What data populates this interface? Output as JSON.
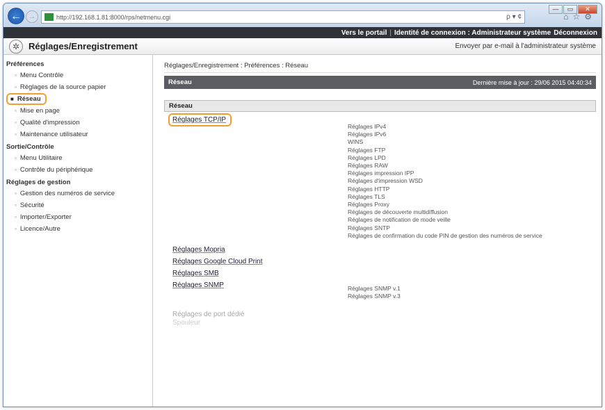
{
  "browser": {
    "url": "http://192.168.1.81:8000/rps/netmenu.cgi",
    "search_hint": "ρ ▾ ¢",
    "window_buttons": [
      "—",
      "▭",
      "✕"
    ]
  },
  "topbar": {
    "portal": "Vers le portail",
    "identity": "Identité de connexion : Administrateur système",
    "logout": "Déconnexion"
  },
  "header": {
    "title": "Réglages/Enregistrement",
    "email": "Envoyer par e-mail à l'administrateur système"
  },
  "sidebar": {
    "sections": [
      {
        "label": "Préférences",
        "items": [
          "Menu Contrôle",
          "Réglages de la source papier",
          "Réseau",
          "Mise en page",
          "Qualité d'impression",
          "Maintenance utilisateur"
        ]
      },
      {
        "label": "Sortie/Contrôle",
        "items": [
          "Menu Utilitaire",
          "Contrôle du périphérique"
        ]
      },
      {
        "label": "Réglages de gestion",
        "items": [
          "Gestion des numéros de service",
          "Sécurité",
          "Importer/Exporter",
          "Licence/Autre"
        ]
      }
    ]
  },
  "content": {
    "breadcrumb": "Réglages/Enregistrement : Préférences : Réseau",
    "section_title": "Réseau",
    "last_update": "Dernière mise à jour : 29/06 2015 04:40:34",
    "subsection": "Réseau",
    "tcpip": {
      "label": "Réglages TCP/IP",
      "items": [
        "Réglages IPv4",
        "Réglages IPv6",
        "WINS",
        "Réglages FTP",
        "Réglages LPD",
        "Réglages RAW",
        "Réglages impression IPP",
        "Réglages d'impression WSD",
        "Réglages HTTP",
        "Réglages TLS",
        "Réglages Proxy",
        "Réglages de découverte multidiffusion",
        "Réglages de notification de mode veille",
        "Réglages SNTP",
        "Réglages de confirmation du code PIN de gestion des numéros de service"
      ]
    },
    "links": [
      "Réglages Mopria",
      "Réglages Google Cloud Print",
      "Réglages SMB"
    ],
    "snmp": {
      "label": "Réglages SNMP",
      "items": [
        "Réglages SNMP v.1",
        "Réglages SNMP v.3"
      ]
    },
    "faded": [
      "Réglages de port dédié",
      "Spouleur"
    ]
  }
}
